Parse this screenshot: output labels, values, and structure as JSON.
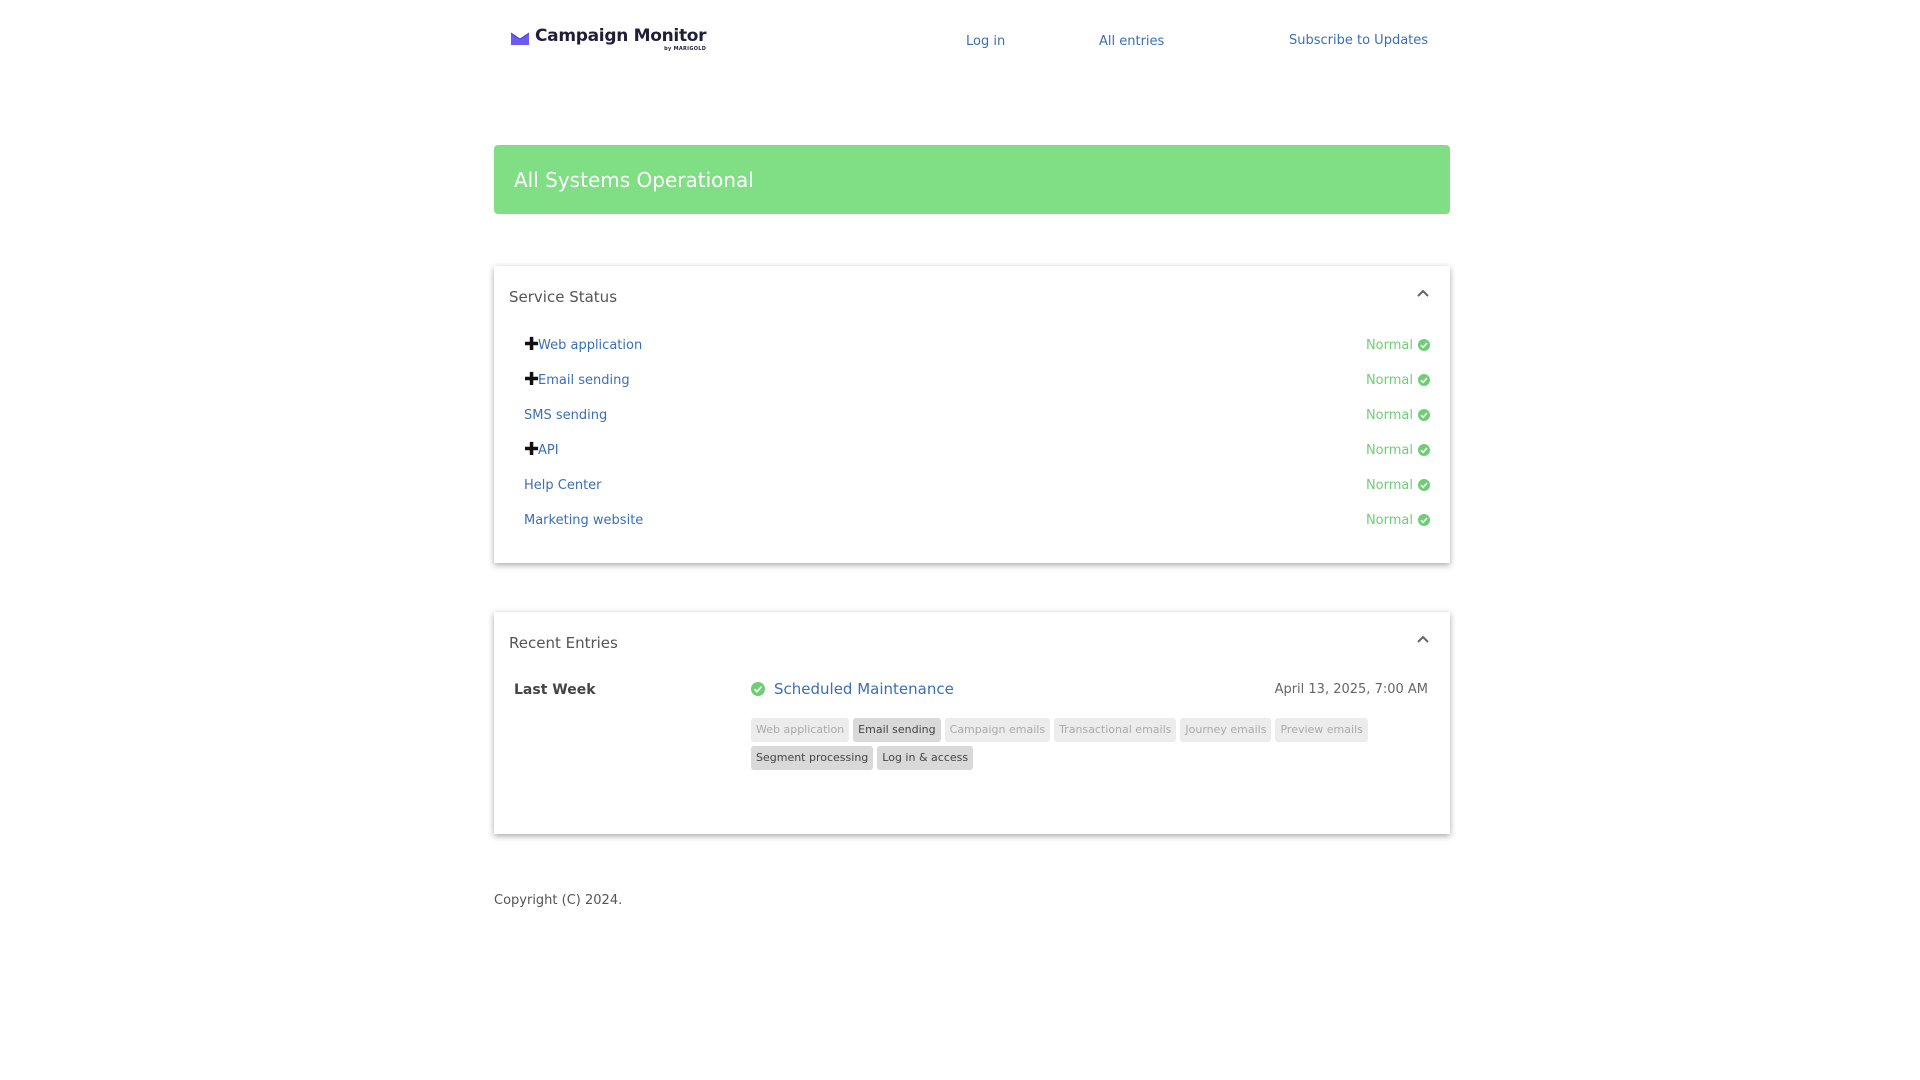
{
  "header": {
    "logo_name": "Campaign Monitor",
    "logo_sub": "by MARIGOLD",
    "nav": {
      "login": "Log in",
      "all_entries": "All entries",
      "subscribe": "Subscribe to Updates"
    }
  },
  "banner": {
    "text": "All Systems Operational",
    "color": "#80df84"
  },
  "service_status": {
    "title": "Service Status",
    "toggle_icon": "chevron-up-icon",
    "items": [
      {
        "label": "Web application",
        "expandable": "✚",
        "status": "Normal"
      },
      {
        "label": "Email sending",
        "expandable": "✚",
        "status": "Normal"
      },
      {
        "label": "SMS sending",
        "expandable": "",
        "status": "Normal"
      },
      {
        "label": "API",
        "expandable": "✚",
        "status": "Normal"
      },
      {
        "label": "Help Center",
        "expandable": "",
        "status": "Normal"
      },
      {
        "label": "Marketing website",
        "expandable": "",
        "status": "Normal"
      }
    ],
    "status_color": "#6fce75"
  },
  "recent_entries": {
    "title": "Recent Entries",
    "toggle_icon": "chevron-up-icon",
    "period": "Last Week",
    "entry": {
      "title": "Scheduled Maintenance",
      "date": "April 13, 2025, 7:00 AM",
      "icon": "check-circle-icon",
      "tags": [
        {
          "label": "Web application",
          "affected": false
        },
        {
          "label": "Email sending",
          "affected": true
        },
        {
          "label": "Campaign emails",
          "affected": false
        },
        {
          "label": "Transactional emails",
          "affected": false
        },
        {
          "label": "Journey emails",
          "affected": false
        },
        {
          "label": "Preview emails",
          "affected": false
        },
        {
          "label": "Segment processing",
          "affected": true
        },
        {
          "label": "Log in & access",
          "affected": true
        }
      ]
    }
  },
  "footer": {
    "copyright": "Copyright (C) 2024."
  },
  "colors": {
    "link": "#3a6fb5",
    "brand_purple": "#6b5bf0"
  }
}
